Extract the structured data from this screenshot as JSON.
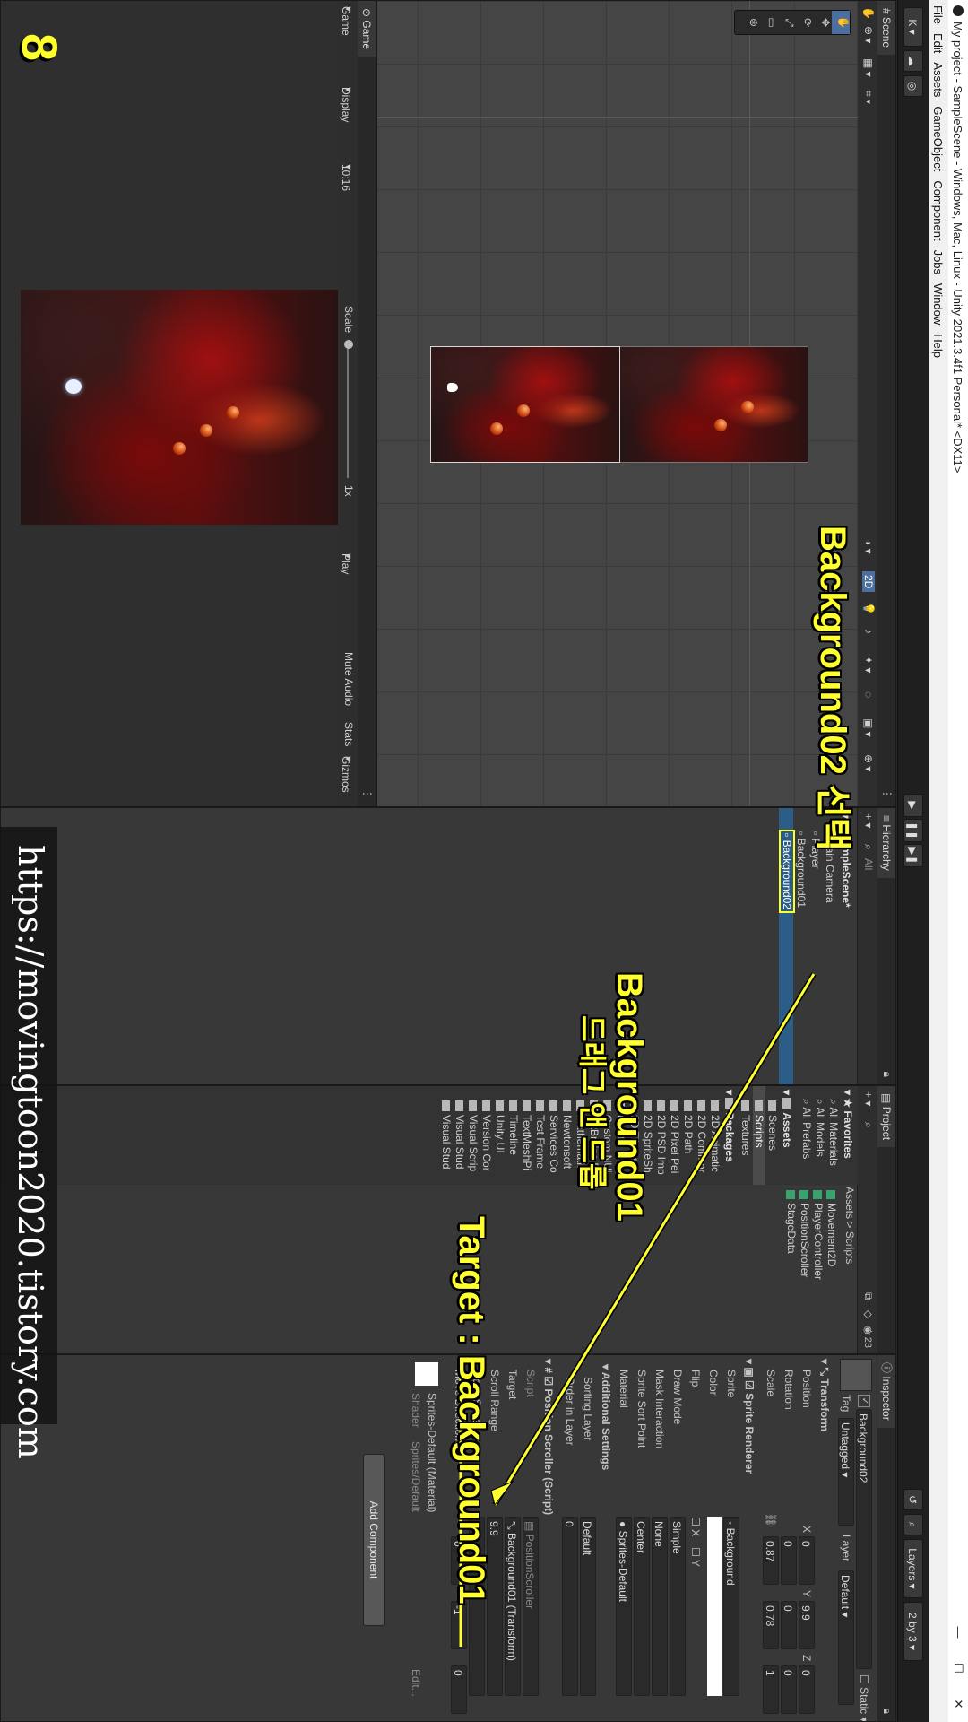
{
  "window": {
    "title": "My project - SampleScene - Windows, Mac, Linux - Unity 2021.3.4f1 Personal* <DX11>"
  },
  "menu": [
    "File",
    "Edit",
    "Assets",
    "GameObject",
    "Component",
    "Jobs",
    "Window",
    "Help"
  ],
  "toolbar": {
    "account": "K",
    "layers": "Layers",
    "layout": "2 by 3"
  },
  "scene": {
    "tab": "Scene",
    "mode_2d": "2D"
  },
  "game": {
    "tab": "Game",
    "display_label": "Game",
    "display": "Display 1",
    "aspect": "10:16",
    "scale_label": "Scale",
    "scale_value": "1x",
    "play_focused": "Play Focused",
    "mute_audio": "Mute Audio",
    "stats": "Stats",
    "gizmos": "Gizmos",
    "counter": "8"
  },
  "hierarchy": {
    "tab": "Hierarchy",
    "search_placeholder": "All",
    "scene_name": "SampleScene*",
    "items": [
      "Main Camera",
      "Player",
      "Background01",
      "Background02"
    ]
  },
  "project": {
    "tab": "Project",
    "favorites_title": "Favorites",
    "favorites": [
      "All Materials",
      "All Models",
      "All Prefabs"
    ],
    "assets_title": "Assets",
    "asset_folders": [
      "Scenes",
      "Scripts",
      "Textures"
    ],
    "packages_title": "Packages",
    "packages": [
      "2D Animatic",
      "2D Commor",
      "2D Path",
      "2D Pixel Pei",
      "2D PSD Imp",
      "2D SpriteSh",
      "2D Tilemap",
      "Burst",
      "Custom NUi",
      "JetBrains Ri",
      "Mathematic",
      "Newtonsoft",
      "Services Co",
      "Test Frame",
      "TextMeshPi",
      "Timeline",
      "Unity UI",
      "Version Cor",
      "Visual Scrip",
      "Visual Stud",
      "Visual Stud"
    ],
    "breadcrumb_root": "Assets",
    "breadcrumb_sep": ">",
    "breadcrumb_leaf": "Scripts",
    "scripts": [
      "Movement2D",
      "PlayerController",
      "PositionScroller",
      "StageData"
    ],
    "count": "23"
  },
  "inspector": {
    "tab": "Inspector",
    "object_name": "Background02",
    "tag_label": "Tag",
    "tag_value": "Untagged",
    "layer_label": "Layer",
    "layer_value": "Default",
    "static_label": "Static",
    "transform_title": "Transform",
    "position_label": "Position",
    "rotation_label": "Rotation",
    "scale_label": "Scale",
    "position": {
      "x": "0",
      "y": "9.9",
      "z": "0"
    },
    "rotation": {
      "x": "0",
      "y": "0",
      "z": "0"
    },
    "scale": {
      "x": "0.87",
      "y": "0.78",
      "z": "1"
    },
    "axis_x": "X",
    "axis_y": "Y",
    "axis_z": "Z",
    "sprite_renderer_title": "Sprite Renderer",
    "sprite_label": "Sprite",
    "sprite_value": "Background",
    "color_label": "Color",
    "flip_label": "Flip",
    "flip_x": "X",
    "flip_y": "Y",
    "draw_mode_label": "Draw Mode",
    "draw_mode_value": "Simple",
    "mask_label": "Mask Interaction",
    "mask_value": "None",
    "sort_point_label": "Sprite Sort Point",
    "sort_point_value": "Center",
    "material_label": "Material",
    "material_value": "Sprites-Default",
    "additional_title": "Additional Settings",
    "sorting_layer_label": "Sorting Layer",
    "sorting_layer_value": "Default",
    "order_label": "Order in Layer",
    "order_value": "0",
    "script_component_title": "Position Scroller (Script)",
    "script_label": "Script",
    "script_value": "PositionScroller",
    "target_label": "Target",
    "target_value": "Background01 (Transform)",
    "scroll_range_label": "Scroll Range",
    "scroll_range_value": "9.9",
    "move_speed_label": "Move Speed",
    "move_dir_label": "Move Direction",
    "move_dir": {
      "x": "0",
      "y": "-1",
      "z": "0"
    },
    "material_preview_name": "Sprites-Default (Material)",
    "shader_label": "Shader",
    "shader_value": "Sprites/Default",
    "edit_label": "Edit...",
    "add_component": "Add Component"
  },
  "annotations": {
    "select_note": "Background02 선택",
    "drag_note_1": "Background01",
    "drag_note_2": "드래그 앤 드롭",
    "target_note": "Target : Background01",
    "watermark": "https://movingtoon2020.tistory.com"
  },
  "colors": {
    "annotation": "#ffff2e",
    "selection": "#2c5d87",
    "editor_bg": "#383838"
  }
}
